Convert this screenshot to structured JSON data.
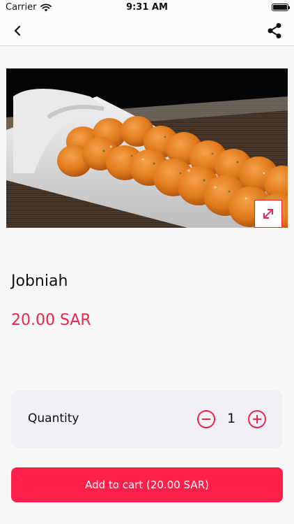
{
  "status_bar": {
    "carrier": "Carrier",
    "time": "9:31 AM"
  },
  "nav": {
    "back_icon": "chevron-left-icon",
    "share_icon": "share-icon"
  },
  "product": {
    "image_alt": "Jobniah",
    "expand_icon": "expand-icon",
    "name": "Jobniah",
    "price": "20.00 SAR"
  },
  "quantity": {
    "label": "Quantity",
    "value": "1",
    "minus_icon": "minus-circle-icon",
    "plus_icon": "plus-circle-icon"
  },
  "cart": {
    "button_label": "Add to cart (20.00 SAR)"
  },
  "colors": {
    "accent": "#ff1f4b",
    "price": "#e8264e",
    "card_bg": "#efeff4",
    "page_bg": "#f7f7f8"
  }
}
